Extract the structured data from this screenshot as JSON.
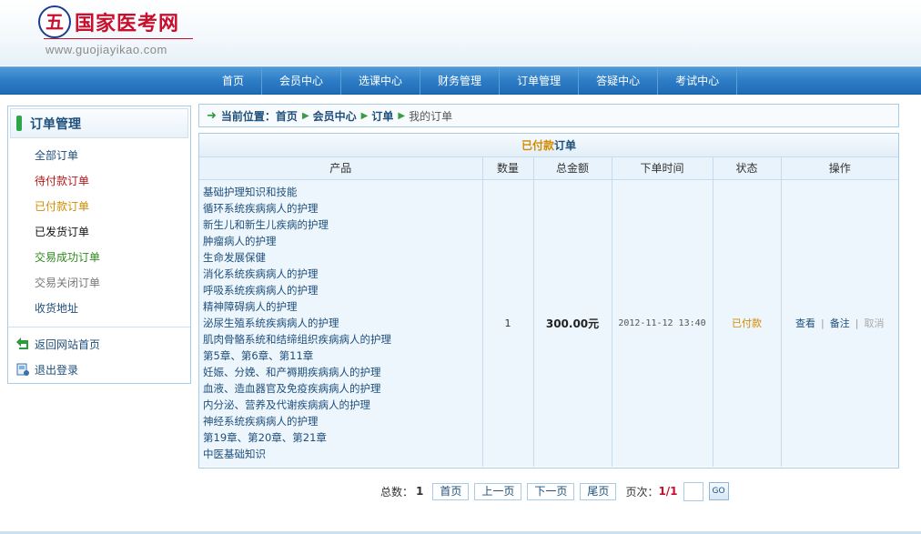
{
  "brand": {
    "logo_char": "五",
    "title": "国家医考网",
    "url": "www.guojiayikao.com"
  },
  "nav": {
    "items": [
      "首页",
      "会员中心",
      "选课中心",
      "财务管理",
      "订单管理",
      "答疑中心",
      "考试中心"
    ]
  },
  "sidebar": {
    "title": "订单管理",
    "items": [
      {
        "label": "全部订单",
        "color": "#1f4f7a"
      },
      {
        "label": "待付款订单",
        "color": "#b01818"
      },
      {
        "label": "已付款订单",
        "color": "#d18b00"
      },
      {
        "label": "已发货订单",
        "color": "#111111"
      },
      {
        "label": "交易成功订单",
        "color": "#2f8a1e"
      },
      {
        "label": "交易关闭订单",
        "color": "#777777"
      },
      {
        "label": "收货地址",
        "color": "#1f4f7a"
      }
    ],
    "links": {
      "home": "返回网站首页",
      "logout": "退出登录"
    }
  },
  "breadcrumb": {
    "label": "当前位置：",
    "items": [
      "首页",
      "会员中心",
      "订单"
    ],
    "current": "我的订单"
  },
  "orders": {
    "title_status": "已付款",
    "title_suffix": "订单",
    "columns": [
      "产品",
      "数量",
      "总金额",
      "下单时间",
      "状态",
      "操作"
    ],
    "products": [
      "基础护理知识和技能",
      "循环系统疾病病人的护理",
      "新生儿和新生儿疾病的护理",
      "肿瘤病人的护理",
      "生命发展保健",
      "消化系统疾病病人的护理",
      "呼吸系统疾病病人的护理",
      "精神障碍病人的护理",
      "泌尿生殖系统疾病病人的护理",
      "肌肉骨骼系统和结缔组织疾病病人的护理",
      "第5章、第6章、第11章",
      "妊娠、分娩、和产褥期疾病病人的护理",
      "血液、造血器官及免疫疾病病人的护理",
      "内分泌、营养及代谢疾病病人的护理",
      "神经系统疾病病人的护理",
      "第19章、第20章、第21章",
      "中医基础知识"
    ],
    "quantity": "1",
    "total": "300.00元",
    "time": "2012-11-12 13:40",
    "status": "已付款",
    "actions": {
      "view": "查看",
      "note": "备注",
      "cancel": "取消"
    }
  },
  "pager": {
    "total_label": "总数：",
    "total": "1",
    "first": "首页",
    "prev": "上一页",
    "next": "下一页",
    "last": "尾页",
    "page_label": "页次：",
    "page": "1/1",
    "go": "GO"
  }
}
